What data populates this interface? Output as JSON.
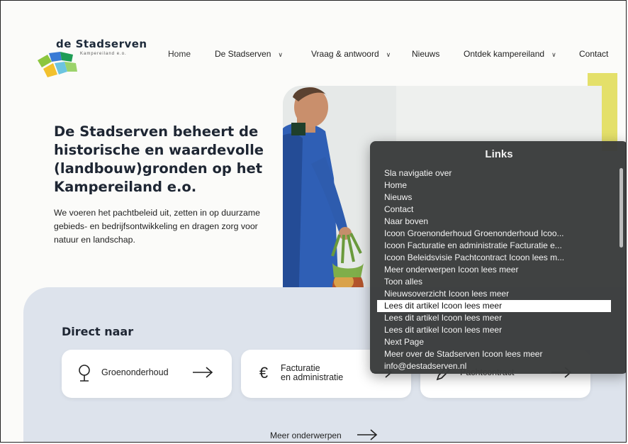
{
  "logo": {
    "title": "de Stadserven",
    "subtitle": "Kampereiland e.o."
  },
  "nav": [
    {
      "label": "Home",
      "dropdown": false
    },
    {
      "label": "De Stadserven",
      "dropdown": true
    },
    {
      "label": "Vraag & antwoord",
      "dropdown": true
    },
    {
      "label": "Nieuws",
      "dropdown": false
    },
    {
      "label": "Ontdek kampereiland",
      "dropdown": true
    },
    {
      "label": "Contact",
      "dropdown": false
    }
  ],
  "hero": {
    "title": "De Stadserven beheert de historische en waardevolle (landbouw)gronden op het Kampereiland e.o.",
    "text": "We voeren het pachtbeleid uit, zetten in op duurzame gebieds- en bedrijfsontwikkeling en dragen zorg voor natuur en landschap."
  },
  "direct": {
    "title": "Direct naar",
    "cards": [
      {
        "label": "Groenonderhoud",
        "icon": "tree-icon"
      },
      {
        "label_line1": "Facturatie",
        "label_line2": "en administratie",
        "icon": "euro-icon"
      },
      {
        "label": "Pachtcontract",
        "icon": "pen-icon"
      }
    ],
    "more": "Meer onderwerpen"
  },
  "rotor": {
    "title": "Links",
    "selected_index": 11,
    "items": [
      "Sla navigatie over",
      "Home",
      "Nieuws",
      "Contact",
      "Naar boven",
      "Icoon Groenonderhoud Groenonderhoud Icoo...",
      "Icoon Facturatie en administratie Facturatie  e...",
      "Icoon Beleidsvisie Pachtcontract Icoon lees m...",
      "Meer onderwerpen Icoon lees meer",
      "Toon alles",
      "Nieuwsoverzicht Icoon lees meer",
      "Lees dit artikel Icoon lees meer",
      "Lees dit artikel Icoon lees meer",
      "Lees dit artikel Icoon lees meer",
      "Next Page",
      "Meer over de Stadserven Icoon lees meer",
      "info@destadserven.nl"
    ]
  },
  "colors": {
    "panel": "#dde3ec",
    "accent_yellow": "#e4e06a",
    "rotor_bg": "#3a3c3c"
  }
}
